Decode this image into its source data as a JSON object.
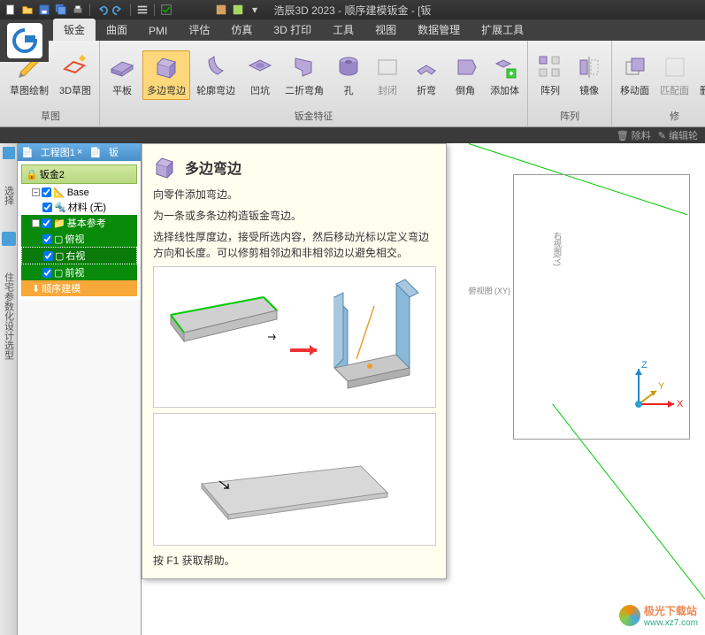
{
  "app": {
    "title": "浩辰3D 2023 - 顺序建模钣金 - [钣",
    "logo_letter": "G"
  },
  "qat": {
    "items": [
      "new",
      "open",
      "save",
      "saveall",
      "print",
      "sep",
      "undo",
      "redo",
      "sep",
      "props",
      "sep",
      "check",
      "sep",
      "config",
      "match"
    ]
  },
  "ribbon": {
    "tabs": [
      "钣金",
      "曲面",
      "PMI",
      "评估",
      "仿真",
      "3D 打印",
      "工具",
      "视图",
      "数据管理",
      "扩展工具"
    ],
    "active_tab": 0,
    "groups": {
      "sketch": {
        "label": "草图",
        "items": [
          {
            "label": "草图绘制"
          },
          {
            "label": "3D草图"
          }
        ]
      },
      "feature": {
        "label": "钣金特征",
        "items": [
          {
            "label": "平板"
          },
          {
            "label": "多边弯边"
          },
          {
            "label": "轮廓弯边"
          },
          {
            "label": "凹坑"
          },
          {
            "label": "二折弯角"
          },
          {
            "label": "孔"
          },
          {
            "label": "封闭"
          },
          {
            "label": "折弯"
          },
          {
            "label": "倒角"
          },
          {
            "label": "添加体"
          }
        ]
      },
      "pattern": {
        "label": "阵列",
        "items": [
          {
            "label": "阵列"
          },
          {
            "label": "镜像"
          }
        ]
      },
      "modify": {
        "label": "修",
        "items": [
          {
            "label": "移动面"
          },
          {
            "label": "匹配面"
          },
          {
            "label": "删除面"
          }
        ]
      }
    }
  },
  "statusbar": {
    "remove": "除料",
    "edit": "编辑轮"
  },
  "tree": {
    "tab1": "工程图1",
    "tab2": "钣",
    "root": "钣金2",
    "items": [
      {
        "label": "Base",
        "indent": 1,
        "chk": true
      },
      {
        "label": "材料 (无)",
        "indent": 2,
        "chk": true
      },
      {
        "label": "基本参考",
        "indent": 1,
        "chk": true,
        "cls": "hl"
      },
      {
        "label": "俯视",
        "indent": 2,
        "chk": true,
        "cls": "hl"
      },
      {
        "label": "右视",
        "indent": 2,
        "chk": true,
        "cls": "hl2"
      },
      {
        "label": "前视",
        "indent": 2,
        "chk": true,
        "cls": "hl"
      },
      {
        "label": "顺序建模",
        "indent": 1,
        "chk": false,
        "cls": "orange"
      }
    ]
  },
  "sidebar": {
    "label1": "选择",
    "label2": "住宅参数化设计选型"
  },
  "tooltip": {
    "title": "多边弯边",
    "desc1": "向零件添加弯边。",
    "desc2": "为一条或多条边构造钣金弯边。",
    "desc3": "选择线性厚度边，接受所选内容，然后移动光标以定义弯边方向和长度。可以修剪相邻边和非相邻边以避免相交。",
    "footer": "按 F1 获取帮助。"
  },
  "viewport": {
    "ref1": "右视图(Y)",
    "ref2": "俯视图 (XY)"
  },
  "watermark": {
    "name": "极光下载站",
    "url": "www.xz7.com"
  }
}
